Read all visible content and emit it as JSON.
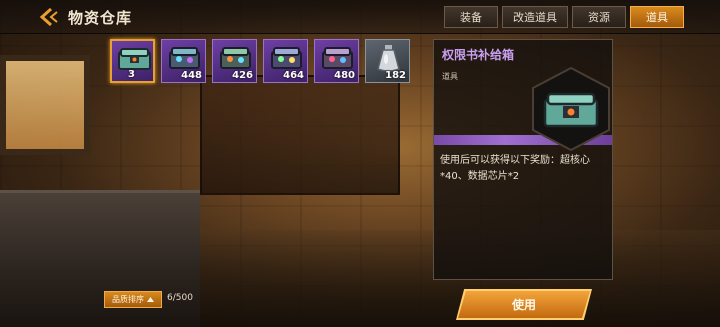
{
  "header": {
    "title": "物资仓库",
    "tabs": [
      {
        "label": "装备",
        "active": false
      },
      {
        "label": "改造道具",
        "active": false
      },
      {
        "label": "资源",
        "active": false
      },
      {
        "label": "道具",
        "active": true
      }
    ]
  },
  "inventory": {
    "items": [
      {
        "count": "3",
        "selected": true,
        "icon": "supply-crate-icon",
        "rarity": "purple"
      },
      {
        "count": "448",
        "selected": false,
        "icon": "gem-crate-icon",
        "rarity": "purple"
      },
      {
        "count": "426",
        "selected": false,
        "icon": "gem-crate-icon",
        "rarity": "purple"
      },
      {
        "count": "464",
        "selected": false,
        "icon": "gem-crate-icon",
        "rarity": "purple"
      },
      {
        "count": "480",
        "selected": false,
        "icon": "gem-crate-icon",
        "rarity": "purple"
      },
      {
        "count": "182",
        "selected": false,
        "icon": "flask-icon",
        "rarity": "grey"
      }
    ],
    "sort_label": "品质排序",
    "capacity": "6/500"
  },
  "detail": {
    "name": "权限书补给箱",
    "type": "道具",
    "description": "使用后可以获得以下奖励：超核心*40、数据芯片*2",
    "use_label": "使用"
  },
  "colors": {
    "accent": "#d98a1e",
    "rarity_purple": "#6e3fa5",
    "name_text": "#c99ff0"
  }
}
